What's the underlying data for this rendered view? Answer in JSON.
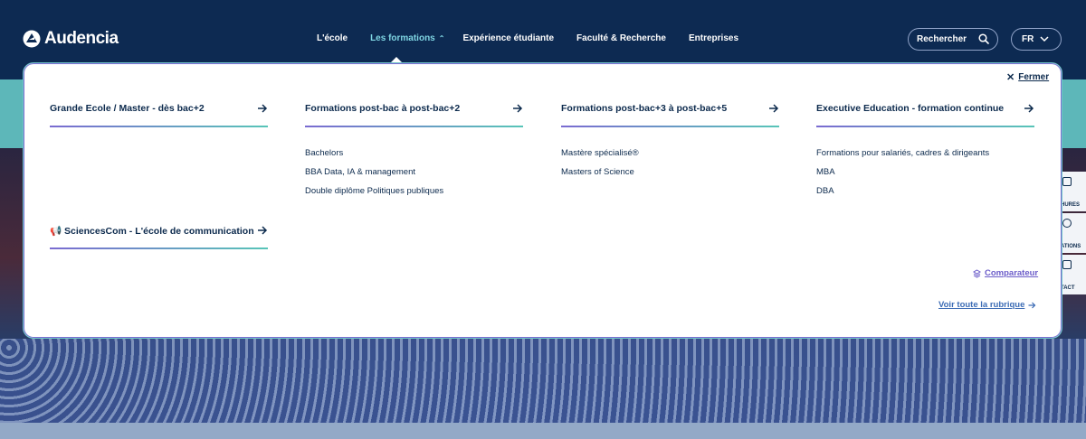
{
  "header": {
    "logo_text": "Audencia",
    "nav": [
      {
        "label": "L'école"
      },
      {
        "label": "Les formations"
      },
      {
        "label": "Expérience étudiante"
      },
      {
        "label": "Faculté & Recherche"
      },
      {
        "label": "Entreprises"
      }
    ],
    "search_label": "Rechercher",
    "lang_label": "FR"
  },
  "menu": {
    "close_label": "Fermer",
    "columns": [
      {
        "title": "Grande Ecole / Master - dès bac+2",
        "links": []
      },
      {
        "title": "Formations post-bac à post-bac+2",
        "links": [
          "Bachelors",
          "BBA Data, IA & management",
          "Double diplôme Politiques publiques"
        ]
      },
      {
        "title": "Formations post-bac+3 à post-bac+5",
        "links": [
          "Mastère spécialisé®",
          "Masters of Science"
        ]
      },
      {
        "title": "Executive Education - formation continue",
        "links": [
          "Formations pour salariés, cadres & dirigeants",
          "MBA",
          "DBA"
        ]
      }
    ],
    "sciencescom": {
      "icon": "📢",
      "title": "SciencesCom - L'école de communication"
    },
    "comparateur_label": "Comparateur",
    "voir_tout_label": "Voir toute la rubrique"
  },
  "side_tabs": [
    "HURES",
    "ATIONS",
    "TACT"
  ],
  "colors": {
    "navy": "#0d2a52",
    "teal": "#5db7b9",
    "accent_purple": "#7a6bd1",
    "link_blue": "#3c6cb5"
  }
}
